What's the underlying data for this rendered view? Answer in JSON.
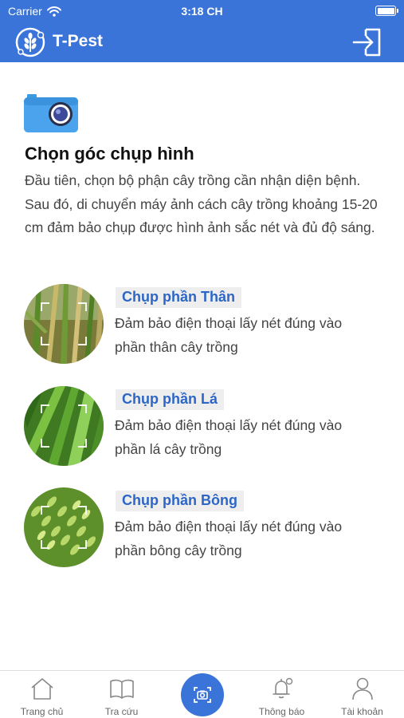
{
  "status_bar": {
    "carrier": "Carrier",
    "time": "3:18 CH"
  },
  "header": {
    "title": "T-Pest",
    "logout_icon": "logout-icon",
    "logo_icon": "wheat-logo-icon"
  },
  "intro": {
    "icon": "camera-icon",
    "title": "Chọn góc chụp hình",
    "description": "Đầu tiên, chọn bộ phận cây trồng cần nhận diện bệnh. Sau đó, di chuyển máy ảnh cách cây trồng khoảng 15-20 cm đảm bảo chụp được hình ảnh sắc nét và đủ độ sáng."
  },
  "options": [
    {
      "title": "Chụp phần Thân",
      "description": "Đảm bảo điện thoại lấy nét đúng vào phần thân cây trồng"
    },
    {
      "title": "Chụp phần Lá",
      "description": "Đảm bảo điện thoại lấy nét đúng vào phần lá cây trồng"
    },
    {
      "title": "Chụp phần Bông",
      "description": "Đảm bảo điện thoại lấy nét đúng vào phần bông cây trồng"
    }
  ],
  "tabs": [
    {
      "label": "Trang chủ",
      "icon": "home-icon"
    },
    {
      "label": "Tra cứu",
      "icon": "book-icon"
    },
    {
      "label": "",
      "icon": "camera-scan-icon"
    },
    {
      "label": "Thông báo",
      "icon": "bell-icon"
    },
    {
      "label": "Tài khoản",
      "icon": "user-icon"
    }
  ],
  "colors": {
    "primary": "#3a74d8",
    "option_title": "#2c66c6",
    "option_title_bg": "#eeeeee",
    "text_muted": "#444444"
  }
}
